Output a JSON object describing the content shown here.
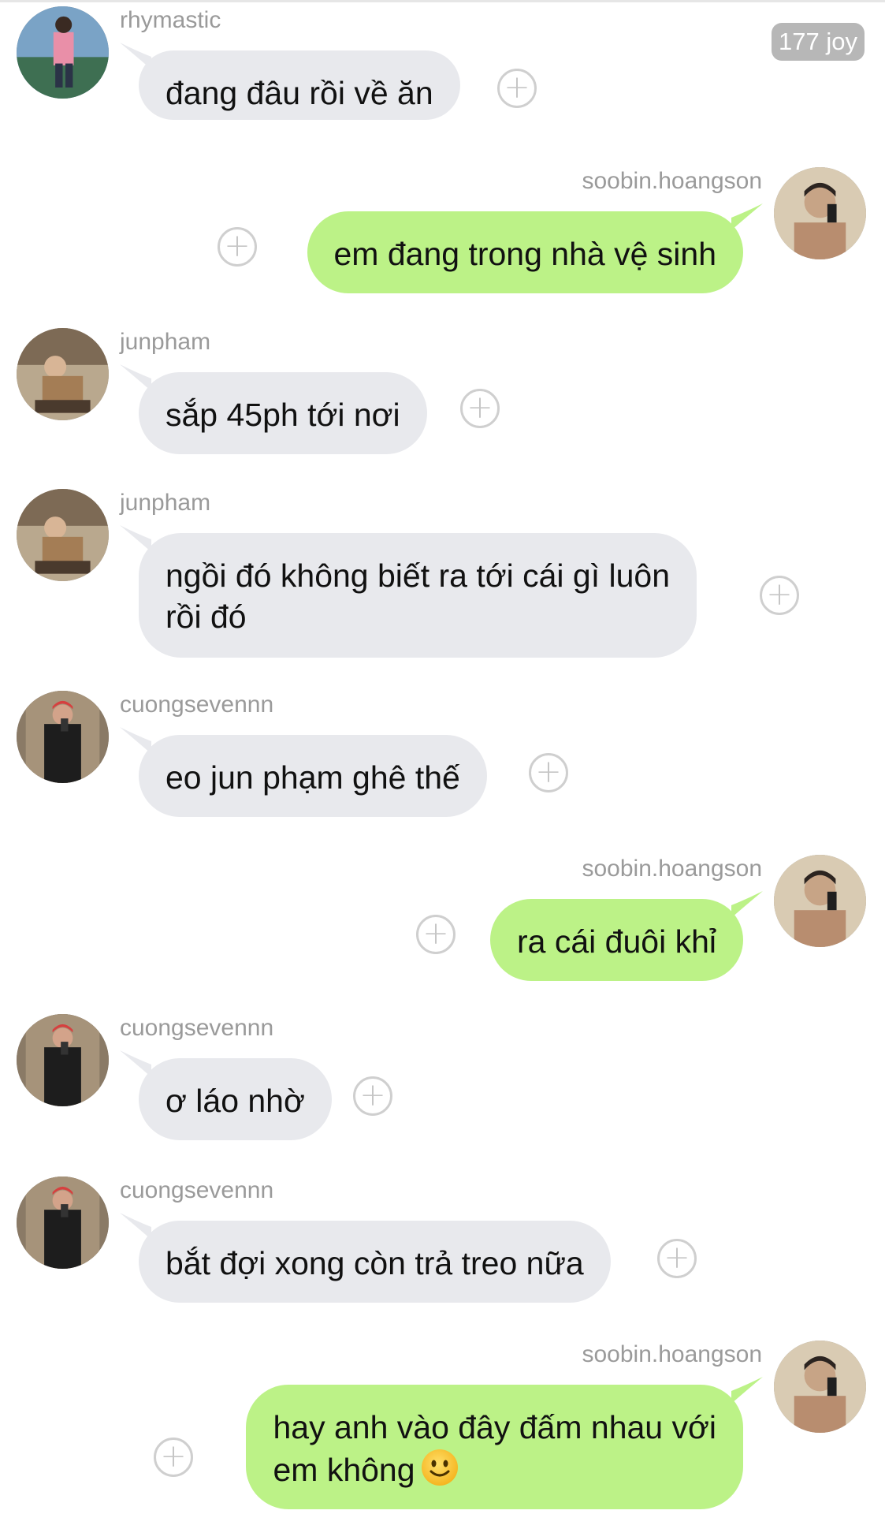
{
  "header": {
    "badge": "177 joy"
  },
  "messages": [
    {
      "user": "rhymastic",
      "text": "đang đâu rồi về ăn",
      "plus": "+"
    },
    {
      "user": "soobin.hoangson",
      "text": "em đang trong nhà vệ sinh",
      "plus": "+"
    },
    {
      "user": "junpham",
      "text": "sắp 45ph tới nơi",
      "plus": "+"
    },
    {
      "user": "junpham",
      "text": "ngồi đó không biết ra tới cái gì luôn\nrồi đó",
      "plus": "+"
    },
    {
      "user": "cuongsevennn",
      "text": "eo jun phạm ghê thế",
      "plus": "+"
    },
    {
      "user": "soobin.hoangson",
      "text": "ra cái đuôi khỉ",
      "plus": "+"
    },
    {
      "user": "cuongsevennn",
      "text": "ơ láo nhờ",
      "plus": "+"
    },
    {
      "user": "cuongsevennn",
      "text": "bắt đợi xong còn trả treo nữa",
      "plus": "+"
    },
    {
      "user": "soobin.hoangson",
      "text": "hay anh vào đây đấm nhau với\nem không",
      "emoji": "slightly-smiling-face",
      "plus": "+"
    }
  ],
  "colors": {
    "incoming_bubble": "#e8e9ed",
    "outgoing_bubble": "#bcf287",
    "username": "#9a9a9a",
    "badge": "#b7b7b7"
  }
}
